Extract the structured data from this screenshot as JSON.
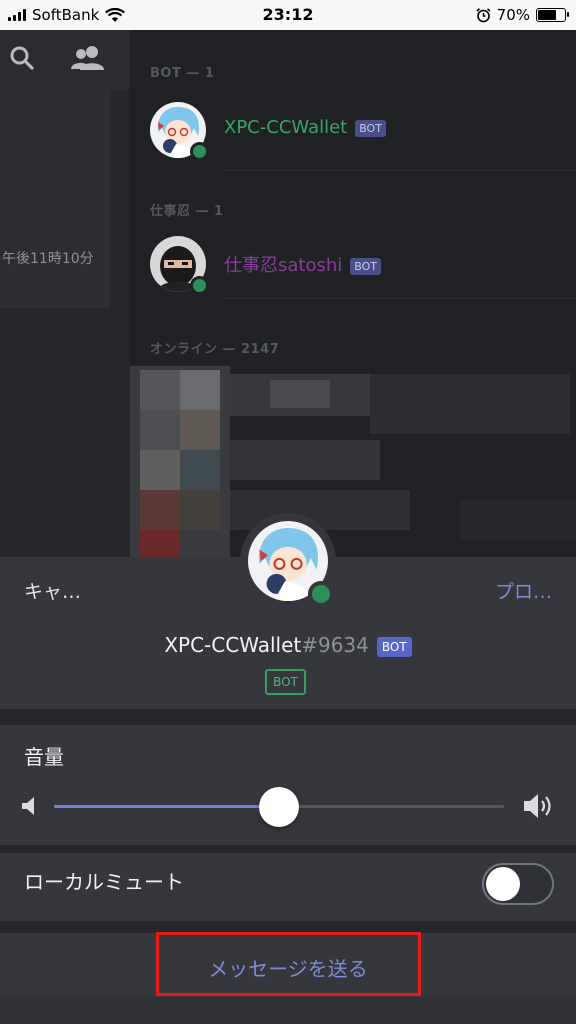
{
  "status_bar": {
    "carrier": "SoftBank",
    "time": "23:12",
    "battery_percent": "70%",
    "battery_level": 0.7
  },
  "background": {
    "left_time": "午後11時10分",
    "sections": [
      {
        "title": "BOT — 1",
        "member": {
          "name": "XPC-CCWallet",
          "tag": "BOT",
          "name_color": "#3ba55d"
        }
      },
      {
        "title": "仕事忍 — 1",
        "member": {
          "name": "仕事忍satoshi",
          "tag": "BOT",
          "name_color": "#8a3d9a"
        }
      },
      {
        "title": "オンライン — 2147"
      }
    ]
  },
  "sheet": {
    "cancel_label": "キャ…",
    "profile_label": "プロ…",
    "username": "XPC-CCWallet",
    "discriminator": "#9634",
    "bot_tag": "BOT",
    "badge_label": "BOT",
    "volume": {
      "label": "音量",
      "level": 0.5
    },
    "local_mute": {
      "label": "ローカルミュート",
      "enabled": false
    },
    "send_message_label": "メッセージを送る"
  },
  "colors": {
    "accent": "#7f8bd6",
    "online": "#2f8f5a",
    "highlight_border": "#e81b1b"
  }
}
